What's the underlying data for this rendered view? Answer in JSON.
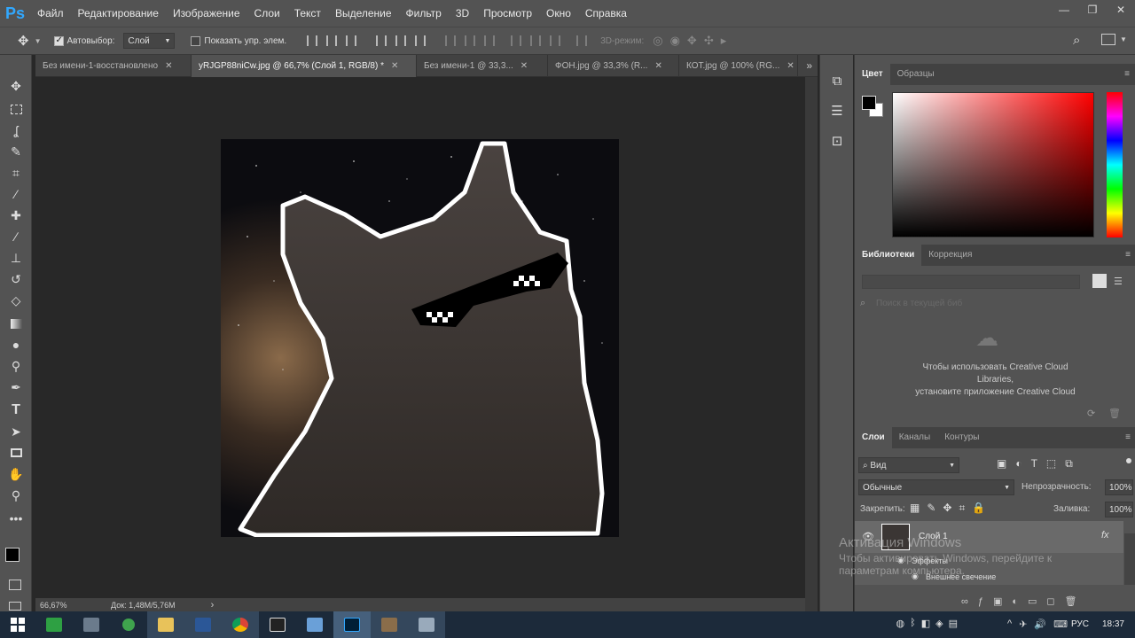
{
  "menubar": {
    "logo": "Ps",
    "items": [
      "Файл",
      "Редактирование",
      "Изображение",
      "Слои",
      "Текст",
      "Выделение",
      "Фильтр",
      "3D",
      "Просмотр",
      "Окно",
      "Справка"
    ],
    "win_min": "—",
    "win_restore": "❐",
    "win_close": "✕"
  },
  "options": {
    "autoselect_label": "Автовыбор:",
    "autoselect_value": "Слой",
    "show_transform_label": "Показать упр. элем.",
    "mode3d_label": "3D-режим:"
  },
  "tabs": [
    {
      "label": "Без имени-1-восстановлено",
      "close": "✕"
    },
    {
      "label": "yRJGP88niCw.jpg @ 66,7% (Слой 1, RGB/8) *",
      "close": "✕"
    },
    {
      "label": "Без имени-1 @ 33,3...",
      "close": "✕"
    },
    {
      "label": "ФОН.jpg @ 33,3% (R...",
      "close": "✕"
    },
    {
      "label": "КОТ.jpg @ 100% (RG...",
      "close": "✕"
    }
  ],
  "tabs_overflow": "»",
  "status": {
    "zoom": "66,67%",
    "doc": "Док: 1,48M/5,76M",
    "arrow": "›"
  },
  "color_panel": {
    "tab_color": "Цвет",
    "tab_swatches": "Образцы",
    "menu": "≡"
  },
  "libraries": {
    "tab_libraries": "Библиотеки",
    "tab_correction": "Коррекция",
    "search_placeholder": "Поиск в текущей биб",
    "message_line1": "Чтобы использовать Creative Cloud",
    "message_line2": "Libraries,",
    "message_line3": "установите приложение Creative Cloud"
  },
  "layers": {
    "tab_layers": "Слои",
    "tab_channels": "Каналы",
    "tab_paths": "Контуры",
    "filter_kind": "Вид",
    "blend_mode": "Обычные",
    "opacity_label": "Непрозрачность:",
    "opacity_value": "100%",
    "lock_label": "Закрепить:",
    "fill_label": "Заливка:",
    "fill_value": "100%",
    "layer_name": "Слой 1",
    "fx_badge": "fx",
    "effects_label": "Эффекты",
    "outer_glow_label": "Внешнее свечение"
  },
  "watermark": {
    "line1": "Активация Windows",
    "line2": "Чтобы активировать Windows, перейдите к",
    "line3": "параметрам компьютера."
  },
  "taskbar": {
    "lang": "РУС",
    "time": "18:37",
    "tray": [
      "^",
      "✈",
      "🔊",
      "⌨"
    ]
  },
  "colors": {
    "accent": "#31a8ff",
    "panel": "#535353",
    "canvas_bg": "#282828",
    "taskbar": "#1c2a3a"
  }
}
